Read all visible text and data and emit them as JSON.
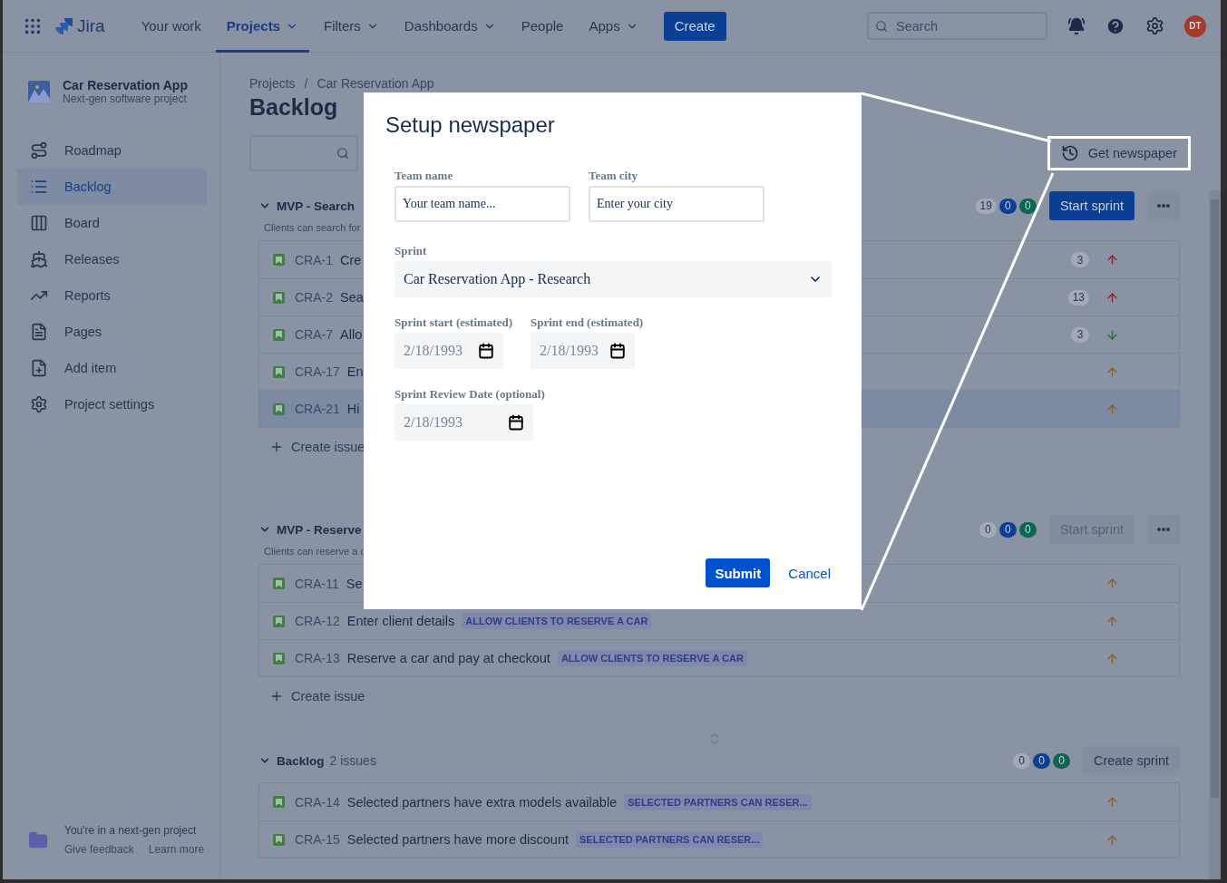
{
  "nav": {
    "logo": "Jira",
    "items": [
      {
        "label": "Your work",
        "dropdown": false,
        "selected": false
      },
      {
        "label": "Projects",
        "dropdown": true,
        "selected": true
      },
      {
        "label": "Filters",
        "dropdown": true,
        "selected": false
      },
      {
        "label": "Dashboards",
        "dropdown": true,
        "selected": false
      },
      {
        "label": "People",
        "dropdown": false,
        "selected": false
      },
      {
        "label": "Apps",
        "dropdown": true,
        "selected": false
      }
    ],
    "create": "Create",
    "search": {
      "placeholder": "Search"
    },
    "avatar": "DT"
  },
  "sidebar": {
    "project": {
      "name": "Car Reservation App",
      "type": "Next-gen software project"
    },
    "items": [
      {
        "label": "Roadmap",
        "selected": false
      },
      {
        "label": "Backlog",
        "selected": true
      },
      {
        "label": "Board",
        "selected": false
      },
      {
        "label": "Releases",
        "selected": false
      },
      {
        "label": "Reports",
        "selected": false
      },
      {
        "label": "Pages",
        "selected": false
      },
      {
        "label": "Add item",
        "selected": false
      },
      {
        "label": "Project settings",
        "selected": false
      }
    ],
    "footer": {
      "text": "You're in a next-gen project",
      "links": [
        "Give feedback",
        "Learn more"
      ]
    }
  },
  "breadcrumbs": {
    "items": [
      "Projects",
      "Car Reservation App"
    ],
    "separator": "/"
  },
  "title": "Backlog",
  "get_newspaper": "Get newspaper",
  "sections": [
    {
      "title": "MVP - Search",
      "description": "Clients can search for",
      "counts": [
        {
          "value": "19",
          "color": "#a3aab7"
        },
        {
          "value": "0",
          "color": "#0b3f94"
        },
        {
          "value": "0",
          "color": "#0d6652"
        }
      ],
      "action": {
        "label": "Start sprint",
        "kind": "primary",
        "disabled": false
      },
      "more": true,
      "issues": [
        {
          "key": "CRA-1",
          "summary": "Cre",
          "points": "3",
          "kind": "highest",
          "selected": false
        },
        {
          "key": "CRA-2",
          "summary": "Sea",
          "points": "13",
          "kind": "highest",
          "selected": false
        },
        {
          "key": "CRA-7",
          "summary": "Allo",
          "points": "3",
          "kind": "low",
          "selected": false
        },
        {
          "key": "CRA-17",
          "summary": "En",
          "kind": "medium",
          "selected": false
        },
        {
          "key": "CRA-21",
          "summary": "Hi",
          "kind": "medium",
          "selected": true
        }
      ],
      "create_issue": "Create issue"
    },
    {
      "title": "MVP - Reserve",
      "description": "Clients can reserve a c",
      "counts": [
        {
          "value": "0",
          "color": "#a3aab7"
        },
        {
          "value": "0",
          "color": "#0b3f94"
        },
        {
          "value": "0",
          "color": "#0d6652"
        }
      ],
      "action": {
        "label": "Start sprint",
        "kind": "primary",
        "disabled": true
      },
      "more": true,
      "issues": [
        {
          "key": "CRA-11",
          "summary": "Se",
          "kind": "medium",
          "selected": false
        },
        {
          "key": "CRA-12",
          "summary": "Enter client details",
          "epic": "ALLOW CLIENTS TO RESERVE A CAR",
          "kind": "medium",
          "selected": false
        },
        {
          "key": "CRA-13",
          "summary": "Reserve a car and pay at checkout",
          "epic": "ALLOW CLIENTS TO RESERVE A CAR",
          "kind": "medium",
          "selected": false
        }
      ],
      "create_issue": "Create issue"
    },
    {
      "title": "Backlog",
      "subtitle": "2 issues",
      "counts": [
        {
          "value": "0",
          "color": "#a3aab7"
        },
        {
          "value": "0",
          "color": "#0b3f94"
        },
        {
          "value": "0",
          "color": "#0d6652"
        }
      ],
      "action": {
        "label": "Create sprint",
        "kind": "subtle",
        "disabled": false
      },
      "more": false,
      "issues": [
        {
          "key": "CRA-14",
          "summary": "Selected partners have extra models available",
          "epic": "SELECTED PARTNERS CAN RESER...",
          "kind": "medium",
          "selected": false
        },
        {
          "key": "CRA-15",
          "summary": "Selected partners have more discount",
          "epic": "SELECTED PARTNERS CAN RESER...",
          "kind": "medium",
          "selected": false
        }
      ]
    }
  ],
  "dialog": {
    "title": "Setup newspaper",
    "team_name": {
      "label": "Team name",
      "placeholder": "Your team name..."
    },
    "team_city": {
      "label": "Team city",
      "placeholder": "Enter your city"
    },
    "sprint": {
      "label": "Sprint",
      "value": "Car Reservation App - Research"
    },
    "sprint_start": {
      "label": "Sprint start (estimated)",
      "value": "2/18/1993"
    },
    "sprint_end": {
      "label": "Sprint end (estimated)",
      "value": "2/18/1993"
    },
    "review_date": {
      "label": "Sprint Review Date (optional)",
      "value": "2/18/1993"
    },
    "submit": "Submit",
    "cancel": "Cancel"
  }
}
